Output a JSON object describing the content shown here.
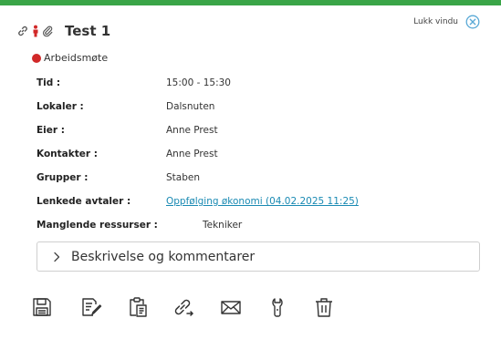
{
  "header": {
    "title": "Test 1",
    "close_label": "Lukk vindu",
    "title_icons": [
      "link-icon",
      "person-icon",
      "paperclip-icon"
    ]
  },
  "appointment_type": {
    "label": "Arbeidsmøte",
    "color": "#d12828"
  },
  "fields": [
    {
      "label": "Tid :",
      "value": "15:00 - 15:30"
    },
    {
      "label": "Lokaler :",
      "value": "Dalsnuten"
    },
    {
      "label": "Eier :",
      "value": "Anne Prest"
    },
    {
      "label": "Kontakter :",
      "value": "Anne Prest"
    },
    {
      "label": "Grupper :",
      "value": "Staben"
    },
    {
      "label": "Lenkede avtaler :",
      "value": "Oppfølging økonomi (04.02.2025 11:25)"
    },
    {
      "label": "Manglende ressurser :",
      "value": "Tekniker"
    }
  ],
  "accordion": {
    "label": "Beskrivelse og kommentarer"
  },
  "toolbar": {
    "icons": [
      "save-icon",
      "edit-icon",
      "copy-icon",
      "link-icon",
      "mail-icon",
      "wrench-icon",
      "trash-icon"
    ]
  },
  "colors": {
    "accent": "#3aa548",
    "link": "#1a8ab3",
    "close": "#5aa9d6",
    "person": "#d12828"
  }
}
